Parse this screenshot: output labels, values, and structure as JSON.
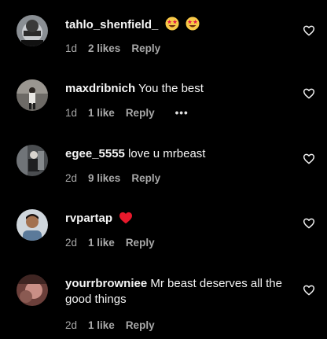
{
  "comments": [
    {
      "username": "tahlo_shenfield_",
      "text": "",
      "emoji": [
        "star-struck-emoji",
        "star-struck-emoji"
      ],
      "time": "1d",
      "likes": "2 likes",
      "reply": "Reply"
    },
    {
      "username": "maxdribnich",
      "text": "You the best",
      "time": "1d",
      "likes": "1 like",
      "reply": "Reply",
      "more": "•••"
    },
    {
      "username": "egee_5555",
      "text": "love u mrbeast",
      "time": "2d",
      "likes": "9 likes",
      "reply": "Reply"
    },
    {
      "username": "rvpartap",
      "text": "",
      "emoji": [
        "red-heart-emoji"
      ],
      "time": "2d",
      "likes": "1 like",
      "reply": "Reply"
    },
    {
      "username": "yourrbrowniee",
      "text": "Mr beast deserves all the good things",
      "time": "2d",
      "likes": "1 like",
      "reply": "Reply"
    }
  ],
  "colors": {
    "background": "#000000",
    "text": "#f5f5f5",
    "muted": "#a8a8a8",
    "heart_emoji": "#e8192c",
    "star_emoji_face": "#f7c948"
  },
  "icons": {
    "like": "heart-outline-icon",
    "more": "more-options-icon"
  }
}
